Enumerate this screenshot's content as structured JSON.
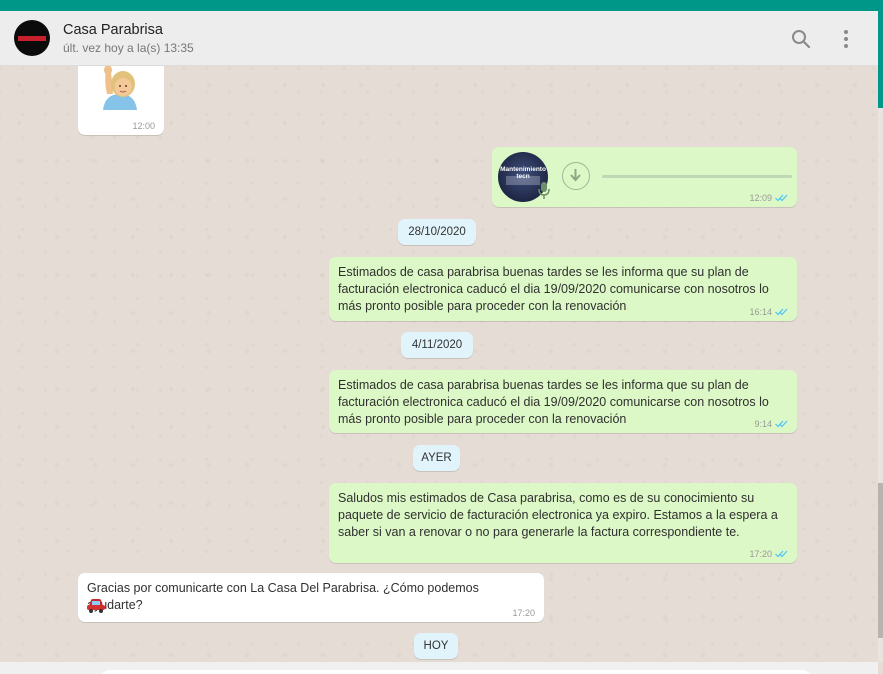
{
  "header": {
    "contact_name": "Casa Parabrisa",
    "last_seen": "últ. vez hoy a la(s) 13:35",
    "avatar_text": "CASAPARABRISA"
  },
  "messages": [
    {
      "direction": "in",
      "type": "sticker",
      "emoji": "raising-hand-woman",
      "time": "12:00"
    },
    {
      "direction": "out",
      "type": "audio",
      "thumb_text": "Mantenimiento tecn",
      "time": "12:09",
      "status": "read"
    },
    {
      "type": "date",
      "label": "28/10/2020"
    },
    {
      "direction": "out",
      "type": "text",
      "text": "Estimados de casa parabrisa buenas tardes se les informa que su plan de facturación electronica caducó el dia 19/09/2020 comunicarse con nosotros lo más pronto posible para proceder con la renovación",
      "time": "16:14",
      "status": "read"
    },
    {
      "type": "date",
      "label": "4/11/2020"
    },
    {
      "direction": "out",
      "type": "text",
      "text": "Estimados de casa parabrisa buenas tardes se les informa que su plan de facturación electronica caducó el dia 19/09/2020 comunicarse con nosotros lo más pronto posible para proceder con la renovación",
      "time": "9:14",
      "status": "read"
    },
    {
      "type": "date",
      "label": "AYER"
    },
    {
      "direction": "out",
      "type": "text",
      "text": "Saludos mis estimados de Casa parabrisa, como es de su conocimiento su paquete de servicio de facturación electronica ya expiro. Estamos a la espera a saber si van a renovar o no para generarle la factura correspondiente te.",
      "time": "17:20",
      "status": "read"
    },
    {
      "direction": "in",
      "type": "text",
      "text": "Gracias por comunicarte con La Casa Del Parabrisa. ¿Cómo podemos ayudarte?",
      "emoji": "car",
      "time": "17:20"
    },
    {
      "type": "date",
      "label": "HOY"
    }
  ],
  "colors": {
    "accent": "#009688",
    "outgoing_bubble": "#dcf8c6",
    "incoming_bubble": "#ffffff",
    "date_pill": "#e1f3fb",
    "read_ticks": "#4fc3f7",
    "chat_background": "#e5ddd5"
  },
  "icons": [
    "search-icon",
    "menu-icon",
    "download-icon",
    "mic-icon",
    "double-check-icon"
  ]
}
